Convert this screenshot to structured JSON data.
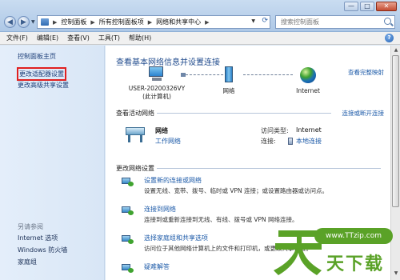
{
  "window": {
    "breadcrumbs": [
      "控制面板",
      "所有控制面板项",
      "网络和共享中心"
    ],
    "search_placeholder": "搜索控制面板",
    "controls": {
      "minimize": "—",
      "maximize": "□",
      "close": "✕"
    }
  },
  "menubar": {
    "items": [
      "文件(F)",
      "编辑(E)",
      "查看(V)",
      "工具(T)",
      "帮助(H)"
    ]
  },
  "sidebar": {
    "links": [
      "控制面板主页",
      "更改适配器设置",
      "更改高级共享设置"
    ],
    "see_also_heading": "另请参阅",
    "see_also": [
      "Internet 选项",
      "Windows 防火墙",
      "家庭组"
    ]
  },
  "main": {
    "title": "查看基本网络信息并设置连接",
    "full_map_link": "查看完整映射",
    "map": {
      "computer_name": "USER-20200326VY",
      "computer_sub": "(此计算机)",
      "network": "网络",
      "internet": "Internet"
    },
    "active_heading": "查看活动网络",
    "connect_link": "连接或断开连接",
    "active_network": {
      "name": "网络",
      "type": "工作网络",
      "access_type_label": "访问类型:",
      "access_type_value": "Internet",
      "connection_label": "连接:",
      "connection_value": "本地连接"
    },
    "change_heading": "更改网络设置",
    "tasks": [
      {
        "link": "设置新的连接或网络",
        "desc": "设置无线、宽带、拨号、临时或 VPN 连接；或设置路由器或访问点。"
      },
      {
        "link": "连接到网络",
        "desc": "连接到或重新连接到无线、有线、拨号或 VPN 网络连接。"
      },
      {
        "link": "选择家庭组和共享选项",
        "desc": "访问位于其他网络计算机上的文件和打印机，或更改共享设置。"
      },
      {
        "link": "疑难解答",
        "desc": ""
      }
    ]
  },
  "watermark": {
    "url": "www.TTzip.com",
    "brand": "天下载"
  },
  "colors": {
    "link": "#1c5aa8",
    "highlight_box": "#e02020",
    "watermark_green": "#5aa227"
  }
}
